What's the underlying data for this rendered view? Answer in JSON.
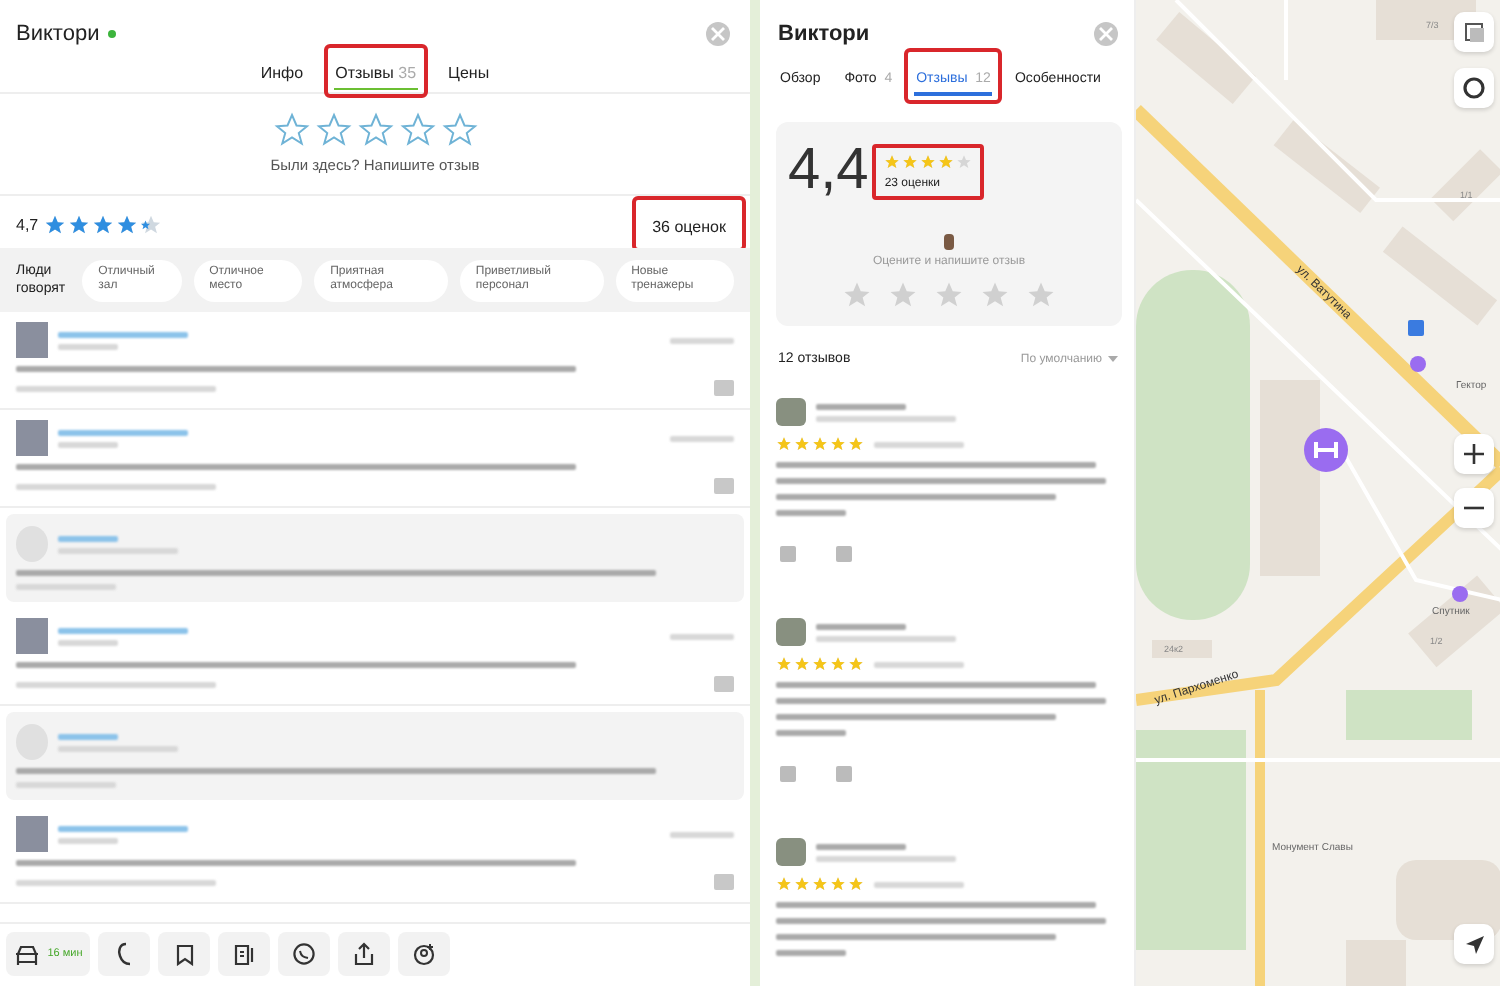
{
  "left_panel": {
    "title": "Виктори",
    "online": true,
    "tabs": [
      {
        "label": "Инфо",
        "selected": false,
        "highlighted": false
      },
      {
        "label": "Отзывы",
        "count": "35",
        "selected": true,
        "highlighted": true
      },
      {
        "label": "Цены",
        "selected": false,
        "highlighted": false
      }
    ],
    "rate_prompt": "Были здесь? Напишите отзыв",
    "rating": {
      "value": "4,7",
      "stars": 4.5,
      "count": "36 оценок",
      "highlighted": true
    },
    "people_say": {
      "label": "Люди говорят",
      "chips": [
        "Отличный зал",
        "Отличное место",
        "Приятная атмосфера",
        "Приветливый персонал",
        "Новые тренажеры"
      ]
    },
    "reviews": [
      {
        "kind": "user"
      },
      {
        "kind": "user"
      },
      {
        "kind": "owner_reply"
      },
      {
        "kind": "user"
      },
      {
        "kind": "owner_reply"
      },
      {
        "kind": "user"
      }
    ],
    "toolbar": {
      "route_time": "16 мин"
    }
  },
  "right_panel": {
    "title": "Виктори",
    "tabs": [
      {
        "label": "Обзор",
        "selected": false,
        "highlighted": false
      },
      {
        "label": "Фото",
        "count": "4",
        "selected": false,
        "highlighted": false
      },
      {
        "label": "Отзывы",
        "count": "12",
        "selected": true,
        "highlighted": true
      },
      {
        "label": "Особенности",
        "selected": false,
        "highlighted": false
      }
    ],
    "rating": {
      "value": "4,4",
      "stars": 4,
      "count": "23 оценки",
      "highlighted": true
    },
    "rate_prompt": "Оцените и напишите отзыв",
    "reviews_count": "12 отзывов",
    "sort": "По умолчанию",
    "reviews": [
      {
        "stars": 5
      },
      {
        "stars": 5
      },
      {
        "stars": 5
      }
    ]
  },
  "map": {
    "labels": [
      {
        "kind": "street",
        "text": "ул. Ватутина"
      },
      {
        "kind": "street",
        "text": "ул. Пархоменко"
      },
      {
        "kind": "place",
        "text": "Монумент Славы"
      },
      {
        "kind": "place",
        "text": "Гектор"
      },
      {
        "kind": "place",
        "text": "Спутник"
      },
      {
        "kind": "house",
        "text": "7/3"
      },
      {
        "kind": "house",
        "text": "1/1"
      },
      {
        "kind": "house",
        "text": "24к2"
      },
      {
        "kind": "house",
        "text": "1/2"
      }
    ]
  }
}
